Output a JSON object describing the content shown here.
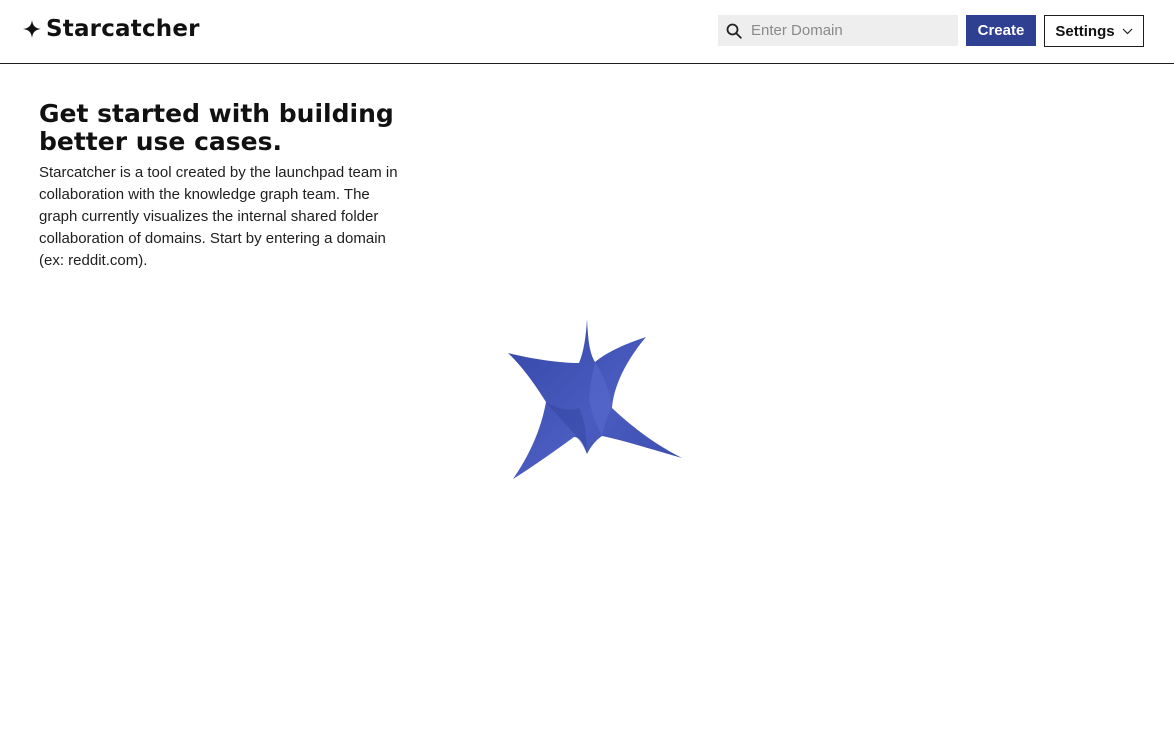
{
  "app": {
    "name": "Starcatcher",
    "accent_color": "#2f3f91",
    "brand_icon": "four-point-star-icon"
  },
  "header": {
    "search": {
      "icon": "search-icon",
      "value": "",
      "placeholder": "Enter Domain"
    },
    "create_label": "Create",
    "settings_label": "Settings",
    "settings_icon": "chevron-down-icon"
  },
  "intro": {
    "title": "Get started with building better use cases.",
    "body": "Starcatcher is a tool created by the launchpad team in collaboration with the knowledge graph team. The graph currently visualizes the internal shared folder collaboration of domains. Start by entering a domain (ex: reddit.com)."
  },
  "graph": {
    "icon": "star-graph-loader-icon",
    "color": "#3d4fae"
  }
}
